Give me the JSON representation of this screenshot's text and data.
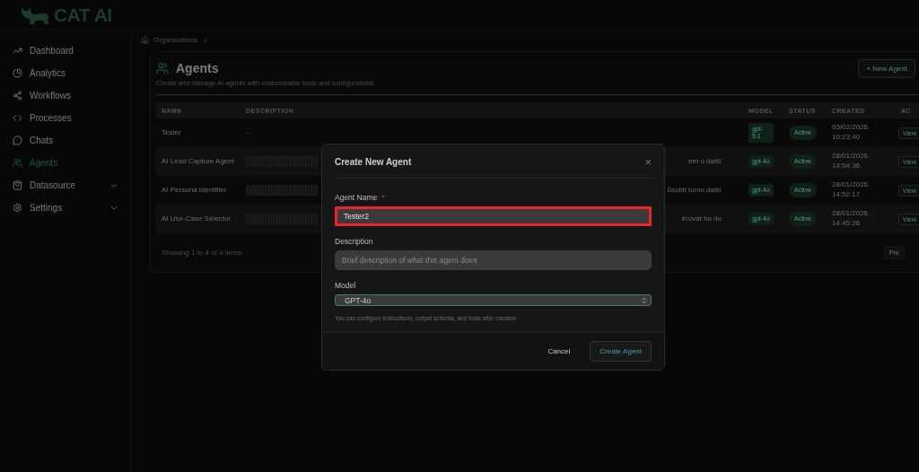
{
  "brand": {
    "name": "CAT AI"
  },
  "sidebar": {
    "items": [
      {
        "label": "Dashboard",
        "selected": false,
        "expandable": false
      },
      {
        "label": "Analytics",
        "selected": false,
        "expandable": false
      },
      {
        "label": "Workflows",
        "selected": false,
        "expandable": false
      },
      {
        "label": "Processes",
        "selected": false,
        "expandable": false
      },
      {
        "label": "Chats",
        "selected": false,
        "expandable": false
      },
      {
        "label": "Agents",
        "selected": true,
        "expandable": false
      },
      {
        "label": "Datasource",
        "selected": false,
        "expandable": true
      },
      {
        "label": "Settings",
        "selected": false,
        "expandable": true
      }
    ]
  },
  "breadcrumb": [
    "Organizations"
  ],
  "page": {
    "title": "Agents",
    "subtitle": "Create and manage AI agents with customizable tools and configurations.",
    "new_button": "+ New Agent"
  },
  "table": {
    "columns": [
      "NAME",
      "DESCRIPTION",
      "MODEL",
      "STATUS",
      "CREATED",
      "AC"
    ],
    "rows": [
      {
        "name": "Tester",
        "description": "-",
        "redacted": false,
        "model": "gpt-5.1",
        "status": "Active",
        "created": "03/02/2026, 10:23:40",
        "action": "View"
      },
      {
        "name": "AI Lead Capture Agent",
        "description": "em o další",
        "redacted": true,
        "model": "gpt-4o",
        "status": "Active",
        "created": "28/01/2026, 14:54:36",
        "action": "View"
      },
      {
        "name": "AI Persona Identifier",
        "description": "ůsobit tomu další",
        "redacted": true,
        "model": "gpt-4o",
        "status": "Active",
        "created": "28/01/2026, 14:52:17",
        "action": "View"
      },
      {
        "name": "AI Use-Case Selector",
        "description": "ěrovat ho do",
        "redacted": true,
        "model": "gpt-4o",
        "status": "Active",
        "created": "28/01/2026, 14:45:26",
        "action": "View"
      }
    ],
    "footer": "Showing 1 to 4 of 4 items",
    "pager": "Pre"
  },
  "dialog": {
    "title": "Create New Agent",
    "close": "×",
    "name_label": "Agent Name",
    "required_mark": "*",
    "name_value": "Tester2",
    "name_highlighted": true,
    "description_label": "Description",
    "description_placeholder": "Brief description of what this agent does",
    "model_label": "Model",
    "model_value": "GPT-4o",
    "hint": "You can configure instructions, output schema, and tools after creation.",
    "cancel": "Cancel",
    "submit": "Create Agent"
  }
}
